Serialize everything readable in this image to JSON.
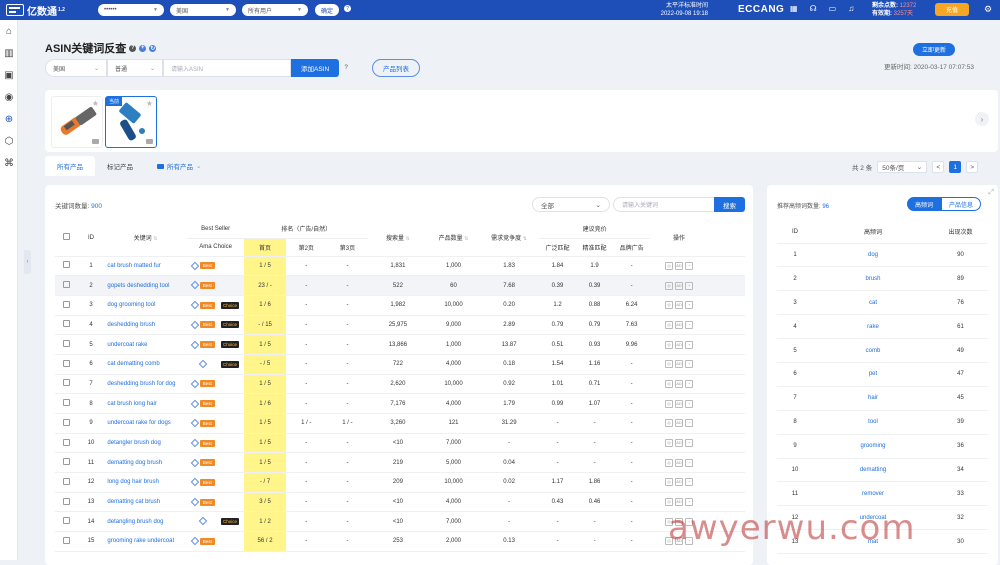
{
  "topbar": {
    "brand": "亿数通",
    "brand_sup": "1.2",
    "store_select": "••••••",
    "site_select": "美国",
    "user_select": "所有用户",
    "confirm_btn": "确定",
    "timezone_label": "太平洋标准时间",
    "timezone_time": "2022-09-08 19:18",
    "eccang": "ECCANG",
    "points_label": "剩余点数:",
    "points_value": "12372",
    "validity_label": "有效期:",
    "validity_value": "3257天",
    "vip_btn": "充值"
  },
  "page": {
    "title": "ASIN关键词反查",
    "country_select": "美国",
    "type_select": "普通",
    "asin_placeholder": "请输入ASIN",
    "add_btn": "添加ASIN",
    "list_btn": "产品列表",
    "update_btn": "立即更新",
    "update_time": "更新时间: 2020-03-17 07:07:53"
  },
  "products": [
    {
      "tag": "",
      "desc": "orange grooming rake"
    },
    {
      "tag": "当前",
      "desc": "blue deshedding brush"
    }
  ],
  "tabs": [
    "所有产品",
    "标记产品",
    "所有产品"
  ],
  "pager": {
    "total": "共 2 条",
    "size": "50条/页",
    "prev": "<",
    "page": "1",
    "next": ">"
  },
  "keyword_panel": {
    "count_label": "关键词数量:",
    "count_value": "900",
    "filter_select": "全部",
    "keyword_placeholder": "请输入关键词",
    "search_btn": "搜索",
    "headers": {
      "id": "ID",
      "keyword": "关键词",
      "bestseller": "Best Seller",
      "amachoice": "Ama Choice",
      "rank_group": "排名（广告/自然）",
      "page1": "首页",
      "page2": "第2页",
      "page3": "第3页",
      "search_vol": "搜索量",
      "product_count": "产品数量",
      "demand": "需求竞争度",
      "bid_group": "建议竞价",
      "broad": "广泛匹配",
      "exact": "精准匹配",
      "brand_ad": "品牌广告",
      "ops": "操作"
    },
    "rows": [
      {
        "id": "1",
        "kw": "cat brush matted fur",
        "best": true,
        "choice": false,
        "p1": "1 / 5",
        "p2": "-",
        "p3": "-",
        "sv": "1,831",
        "pc": "1,000",
        "dc": "1.83",
        "broad": "1.84",
        "exact": "1.9",
        "brand": "-"
      },
      {
        "id": "2",
        "kw": "gopets deshedding tool",
        "best": true,
        "choice": false,
        "p1": "23 / -",
        "p2": "-",
        "p3": "-",
        "sv": "522",
        "pc": "60",
        "dc": "7.68",
        "broad": "0.39",
        "exact": "0.39",
        "brand": "-"
      },
      {
        "id": "3",
        "kw": "dog grooming tool",
        "best": true,
        "choice": true,
        "p1": "1 / 6",
        "p2": "-",
        "p3": "-",
        "sv": "1,982",
        "pc": "10,000",
        "dc": "0.20",
        "broad": "1.2",
        "exact": "0.88",
        "brand": "6.24"
      },
      {
        "id": "4",
        "kw": "deshedding brush",
        "best": true,
        "choice": true,
        "p1": "- / 15",
        "p2": "-",
        "p3": "-",
        "sv": "25,975",
        "pc": "9,000",
        "dc": "2.89",
        "broad": "0.79",
        "exact": "0.79",
        "brand": "7.63"
      },
      {
        "id": "5",
        "kw": "undercoat rake",
        "best": true,
        "choice": true,
        "p1": "1 / 5",
        "p2": "-",
        "p3": "-",
        "sv": "13,866",
        "pc": "1,000",
        "dc": "13.87",
        "broad": "0.51",
        "exact": "0.93",
        "brand": "9.96"
      },
      {
        "id": "6",
        "kw": "cat dematting comb",
        "best": false,
        "choice": true,
        "p1": "- / 5",
        "p2": "-",
        "p3": "-",
        "sv": "722",
        "pc": "4,000",
        "dc": "0.18",
        "broad": "1.54",
        "exact": "1.16",
        "brand": "-"
      },
      {
        "id": "7",
        "kw": "deshedding brush for dog",
        "best": true,
        "choice": false,
        "p1": "1 / 5",
        "p2": "-",
        "p3": "-",
        "sv": "2,620",
        "pc": "10,000",
        "dc": "0.92",
        "broad": "1.01",
        "exact": "0.71",
        "brand": "-"
      },
      {
        "id": "8",
        "kw": "cat brush long hair",
        "best": true,
        "choice": false,
        "p1": "1 / 6",
        "p2": "-",
        "p3": "-",
        "sv": "7,176",
        "pc": "4,000",
        "dc": "1.79",
        "broad": "0.99",
        "exact": "1.07",
        "brand": "-"
      },
      {
        "id": "9",
        "kw": "undercoat rake for dogs",
        "best": true,
        "choice": false,
        "p1": "1 / 5",
        "p2": "1 / -",
        "p3": "1 / -",
        "sv": "3,260",
        "pc": "121",
        "dc": "31.29",
        "broad": "-",
        "exact": "-",
        "brand": "-"
      },
      {
        "id": "10",
        "kw": "detangler brush dog",
        "best": true,
        "choice": false,
        "p1": "1 / 5",
        "p2": "-",
        "p3": "-",
        "sv": "<10",
        "pc": "7,000",
        "dc": "-",
        "broad": "-",
        "exact": "-",
        "brand": "-"
      },
      {
        "id": "11",
        "kw": "dematting dog brush",
        "best": true,
        "choice": false,
        "p1": "1 / 5",
        "p2": "-",
        "p3": "-",
        "sv": "219",
        "pc": "5,000",
        "dc": "0.04",
        "broad": "-",
        "exact": "-",
        "brand": "-"
      },
      {
        "id": "12",
        "kw": "long dog hair brush",
        "best": true,
        "choice": false,
        "p1": "- / 7",
        "p2": "-",
        "p3": "-",
        "sv": "209",
        "pc": "10,000",
        "dc": "0.02",
        "broad": "1.17",
        "exact": "1.86",
        "brand": "-"
      },
      {
        "id": "13",
        "kw": "dematting cat brush",
        "best": true,
        "choice": false,
        "p1": "3 / 5",
        "p2": "-",
        "p3": "-",
        "sv": "<10",
        "pc": "4,000",
        "dc": "-",
        "broad": "0.43",
        "exact": "0.46",
        "brand": "-"
      },
      {
        "id": "14",
        "kw": "detangling brush dog",
        "best": false,
        "choice": true,
        "p1": "1 / 2",
        "p2": "-",
        "p3": "-",
        "sv": "<10",
        "pc": "7,000",
        "dc": "-",
        "broad": "-",
        "exact": "-",
        "brand": "-"
      },
      {
        "id": "15",
        "kw": "grooming rake undercoat",
        "best": true,
        "choice": false,
        "p1": "56 / 2",
        "p2": "-",
        "p3": "-",
        "sv": "253",
        "pc": "2,000",
        "dc": "0.13",
        "broad": "-",
        "exact": "-",
        "brand": "-"
      }
    ]
  },
  "side_panel": {
    "count_label": "推荐高频词数量:",
    "count_value": "96",
    "tab_active": "高频词",
    "tab_other": "产品信息",
    "headers": {
      "id": "ID",
      "word": "高频词",
      "times": "出现次数"
    },
    "rows": [
      {
        "id": "1",
        "w": "dog",
        "n": "90"
      },
      {
        "id": "2",
        "w": "brush",
        "n": "89"
      },
      {
        "id": "3",
        "w": "cat",
        "n": "76"
      },
      {
        "id": "4",
        "w": "rake",
        "n": "61"
      },
      {
        "id": "5",
        "w": "comb",
        "n": "49"
      },
      {
        "id": "6",
        "w": "pet",
        "n": "47"
      },
      {
        "id": "7",
        "w": "hair",
        "n": "45"
      },
      {
        "id": "8",
        "w": "tool",
        "n": "39"
      },
      {
        "id": "9",
        "w": "grooming",
        "n": "36"
      },
      {
        "id": "10",
        "w": "dematting",
        "n": "34"
      },
      {
        "id": "11",
        "w": "remover",
        "n": "33"
      },
      {
        "id": "12",
        "w": "undercoat",
        "n": "32"
      },
      {
        "id": "13",
        "w": "mat",
        "n": "30"
      }
    ]
  },
  "watermark": "awyerwu.com",
  "colors": {
    "primary": "#1e6fe0",
    "topbar": "#1e4fb9",
    "rank_highlight": "#fff58a",
    "best_badge": "#f08a24"
  }
}
